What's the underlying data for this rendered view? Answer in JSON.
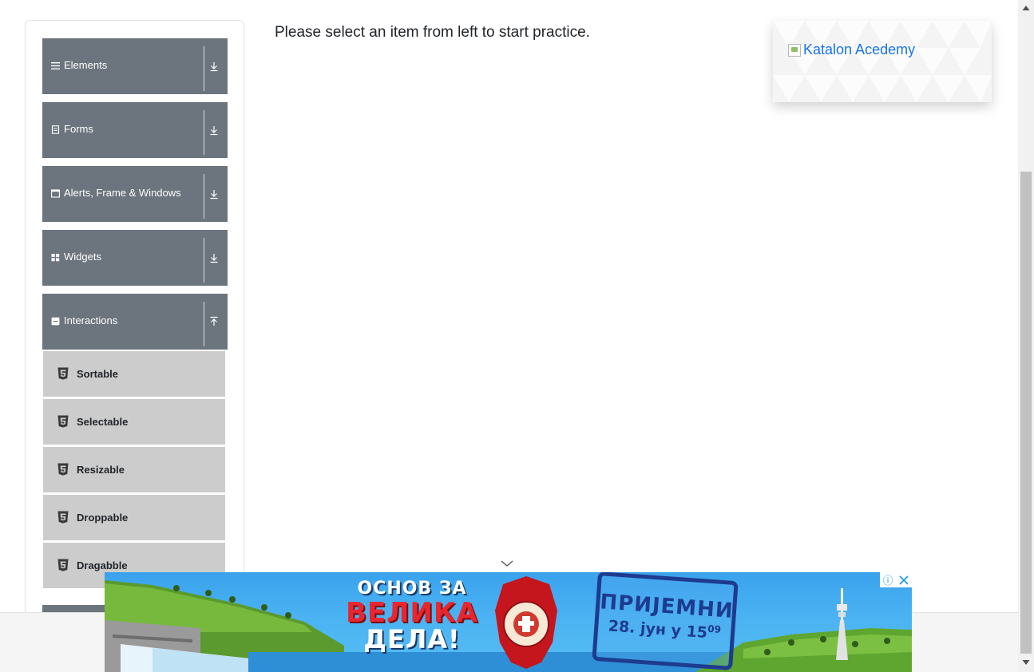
{
  "sidebar": {
    "groups": [
      {
        "label": "Elements",
        "icon": "list-icon"
      },
      {
        "label": "Forms",
        "icon": "form-icon"
      },
      {
        "label": "Alerts, Frame & Windows",
        "icon": "window-icon"
      },
      {
        "label": "Widgets",
        "icon": "grid-icon"
      },
      {
        "label": "Interactions",
        "icon": "collapse-icon"
      }
    ],
    "interactions_items": [
      {
        "label": "Sortable"
      },
      {
        "label": "Selectable"
      },
      {
        "label": "Resizable"
      },
      {
        "label": "Droppable"
      },
      {
        "label": "Dragabble"
      }
    ]
  },
  "main": {
    "instruction": "Please select an item from left to start practice."
  },
  "promo": {
    "alt_text": "Katalon Acedemy"
  },
  "ad": {
    "headline_line1": "ОСНОВ ЗА",
    "headline_line2": "ВЕЛИКА",
    "headline_line3": "ДЕЛА!",
    "stamp_line1": "ПРИЈЕМНИ",
    "stamp_line2": "28. јун у 15",
    "stamp_sup": "09",
    "info_symbol": "ⓘ"
  },
  "colors": {
    "group_header_bg": "#6c757d",
    "sub_item_bg": "#cccccc",
    "link": "#1a73e8",
    "ad_red": "#e8262e",
    "stamp_blue": "#1d3b8f"
  }
}
